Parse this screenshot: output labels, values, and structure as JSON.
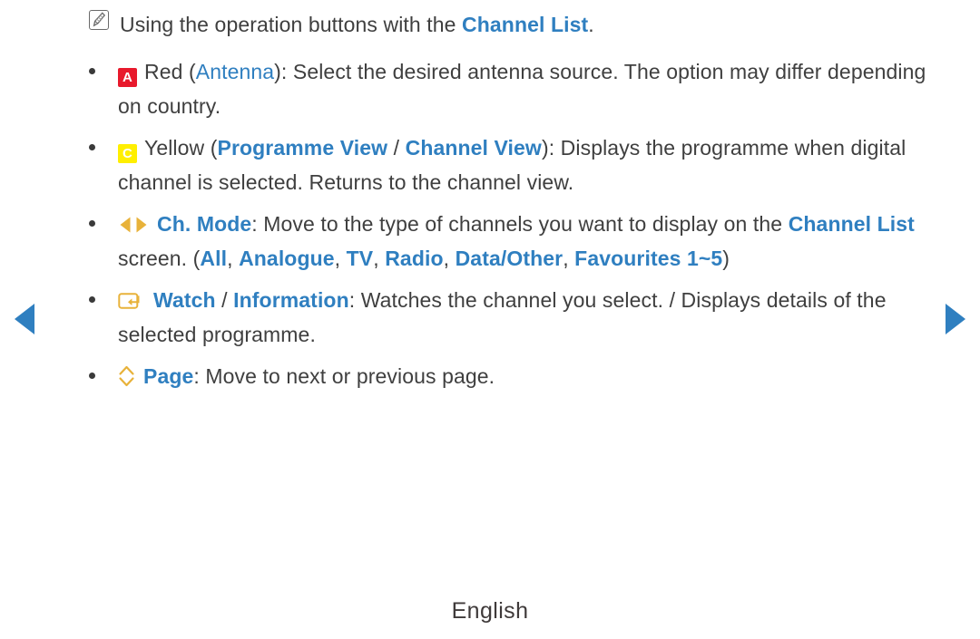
{
  "page": {
    "footer_label": "English",
    "colors": {
      "accent_blue": "#2f7fc0",
      "body_gray": "#3f3f3f",
      "key_red": "#e8192c",
      "key_yellow": "#ffef00",
      "icon_gold": "#e8b23a",
      "nav_arrow_blue": "#2f7fc0"
    }
  },
  "nav": {
    "prev_label": "◀",
    "next_label": "▶"
  },
  "note": {
    "icon": "note-icon",
    "text_before": "Using the operation buttons with the ",
    "highlight": "Channel List",
    "text_after": "."
  },
  "items": [
    {
      "icon": "red-a-key-icon",
      "key_glyph": "A",
      "seg": {
        "s1": "Red (",
        "s2": "Antenna",
        "s3": "): Select the desired antenna source. The option may differ depending on country."
      }
    },
    {
      "icon": "yellow-c-key-icon",
      "key_glyph": "C",
      "seg": {
        "s1": "Yellow (",
        "s2": "Programme View",
        "s3": " / ",
        "s4": "Channel View",
        "s5": "): Displays the programme when digital channel is selected. Returns to the channel view."
      }
    },
    {
      "icon": "left-right-arrows-icon",
      "seg": {
        "s1": "Ch. Mode",
        "s2": ": Move to the type of channels you want to display on the ",
        "s3": "Channel List",
        "s4": " screen. (",
        "s5": "All",
        "s6": ", ",
        "s7": "Analogue",
        "s8": ", ",
        "s9": "TV",
        "s10": ", ",
        "s11": "Radio",
        "s12": ", ",
        "s13": "Data/Other",
        "s14": ", ",
        "s15": "Favourites 1~5",
        "s16": ")"
      }
    },
    {
      "icon": "enter-key-icon",
      "seg": {
        "s1": "Watch",
        "s2": " / ",
        "s3": "Information",
        "s4": ": Watches the channel you select. / Displays details of the selected programme."
      }
    },
    {
      "icon": "up-down-chevrons-icon",
      "seg": {
        "s1": "Page",
        "s2": ": Move to next or previous page."
      }
    }
  ]
}
